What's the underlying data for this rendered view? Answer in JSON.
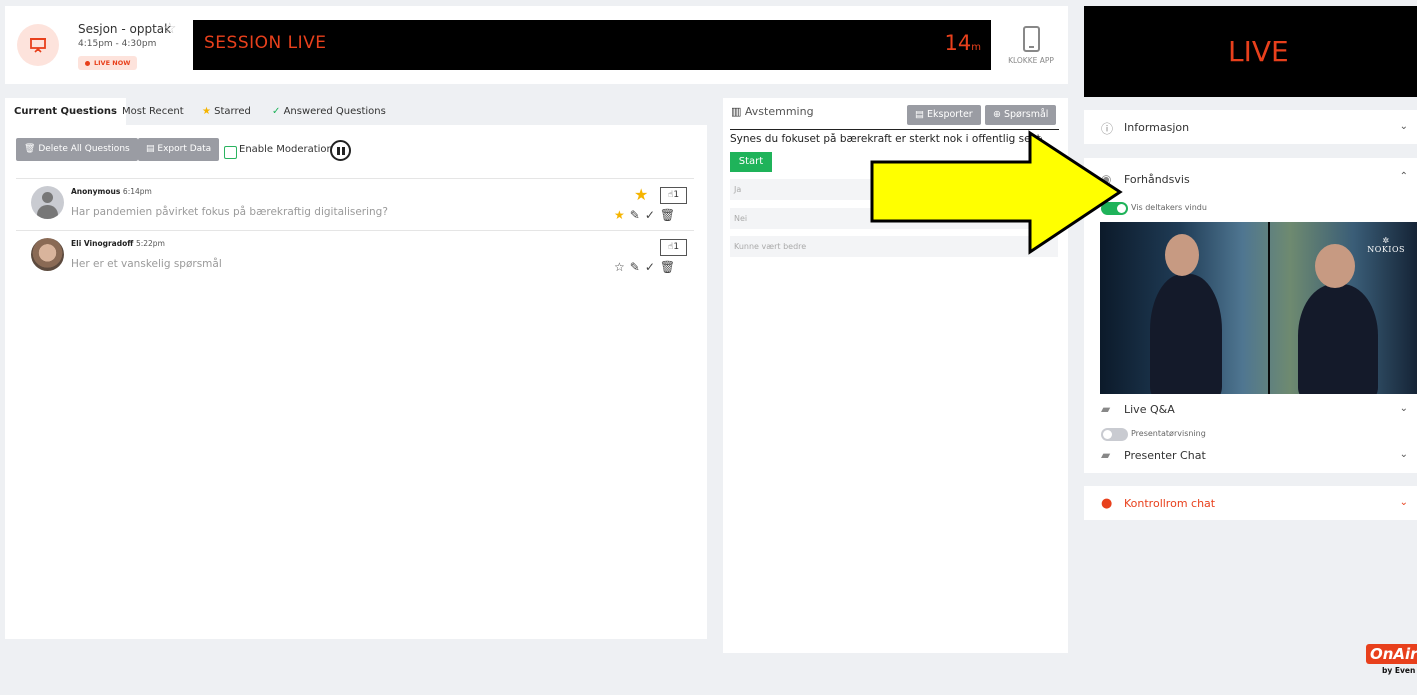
{
  "session": {
    "title": "Sesjon - opptak",
    "time": "4:15pm - 4:30pm",
    "badge": "LIVE NOW",
    "banner_label": "SESSION LIVE",
    "minutes": "14",
    "minutes_unit": "m",
    "clock_app_label": "KLOKKE APP"
  },
  "questions": {
    "tabs": [
      "Current Questions",
      "Most Recent",
      "Starred",
      "Answered Questions"
    ],
    "active_tab": "Current Questions",
    "delete_all_label": "Delete All Questions",
    "export_label": "Export Data",
    "moderation_label": "Enable Moderation",
    "items": [
      {
        "author": "Anonymous",
        "time": "6:14pm",
        "text": "Har pandemien påvirket fokus på bærekraftig digitalisering?",
        "likes": "1",
        "starred": true
      },
      {
        "author": "Eli Vinogradoff",
        "time": "5:22pm",
        "text": "Her er et vanskelig spørsmål",
        "likes": "1",
        "starred": false
      }
    ]
  },
  "poll": {
    "title": "Avstemming",
    "export_label": "Eksporter",
    "question_button_label": "Spørsmål",
    "question": "Synes du fokuset på bærekraft er sterkt nok i offentlig sektor?",
    "start_label": "Start",
    "options": [
      "Ja",
      "Nei",
      "Kunne vært bedre"
    ]
  },
  "right": {
    "live_label": "LIVE",
    "info_label": "Informasjon",
    "preview_label": "Forhåndsvis",
    "show_participant_window": "Vis deltakers vindu",
    "qa_label": "Live Q&A",
    "presenter_view": "Presentatørvisning",
    "presenter_chat": "Presenter Chat",
    "control_room_chat": "Kontrollrom chat",
    "video_brand": "NOKIOS"
  },
  "footer": {
    "brand": "OnAir",
    "brand_sub": "by Even"
  },
  "colors": {
    "accent": "#e8401c",
    "green": "#1fb35a",
    "star": "#f5b400",
    "arrow": "#ffff00"
  }
}
